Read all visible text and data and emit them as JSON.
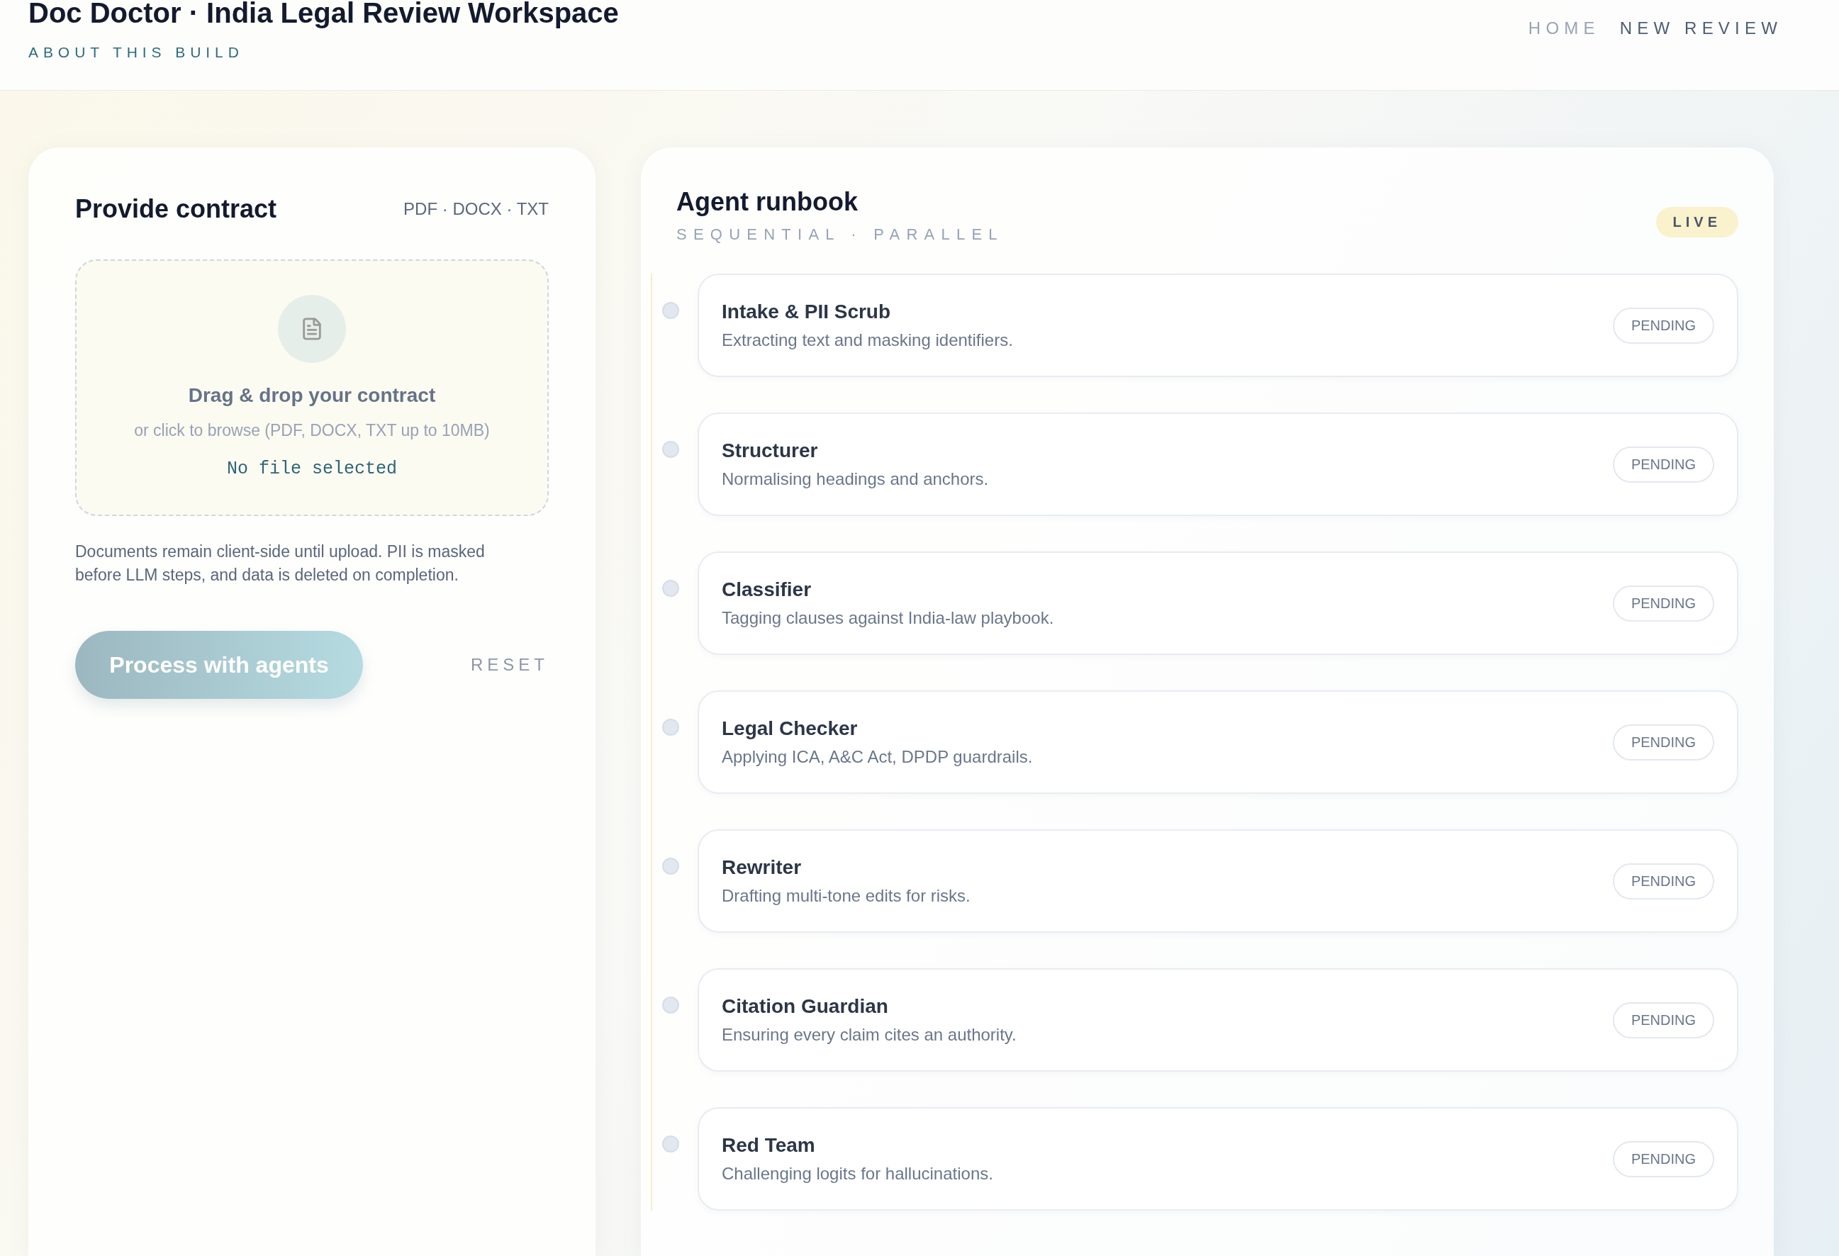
{
  "header": {
    "title": "Doc Doctor · India Legal Review Workspace",
    "subtitle": "ABOUT THIS BUILD",
    "nav": [
      {
        "label": "HOME",
        "selected": false
      },
      {
        "label": "NEW REVIEW",
        "selected": true
      }
    ]
  },
  "upload_panel": {
    "title": "Provide contract",
    "formats": "PDF · DOCX · TXT",
    "dropzone": {
      "title": "Drag & drop your contract",
      "hint": "or click to browse (PDF, DOCX, TXT up to 10MB)",
      "file_status": "No file selected"
    },
    "note": "Documents remain client-side until upload. PII is masked before LLM steps, and data is deleted on completion.",
    "process_button": {
      "label": "Process with agents",
      "disabled": true
    },
    "reset_button": "RESET"
  },
  "runbook": {
    "title": "Agent runbook",
    "subtitle": "SEQUENTIAL · PARALLEL",
    "badge": "LIVE",
    "agents": [
      {
        "name": "Intake & PII Scrub",
        "description": "Extracting text and masking identifiers.",
        "status": "PENDING"
      },
      {
        "name": "Structurer",
        "description": "Normalising headings and anchors.",
        "status": "PENDING"
      },
      {
        "name": "Classifier",
        "description": "Tagging clauses against India-law playbook.",
        "status": "PENDING"
      },
      {
        "name": "Legal Checker",
        "description": "Applying ICA, A&C Act, DPDP guardrails.",
        "status": "PENDING"
      },
      {
        "name": "Rewriter",
        "description": "Drafting multi-tone edits for risks.",
        "status": "PENDING"
      },
      {
        "name": "Citation Guardian",
        "description": "Ensuring every claim cites an authority.",
        "status": "PENDING"
      },
      {
        "name": "Red Team",
        "description": "Challenging logits for hallucinations.",
        "status": "PENDING"
      }
    ]
  }
}
